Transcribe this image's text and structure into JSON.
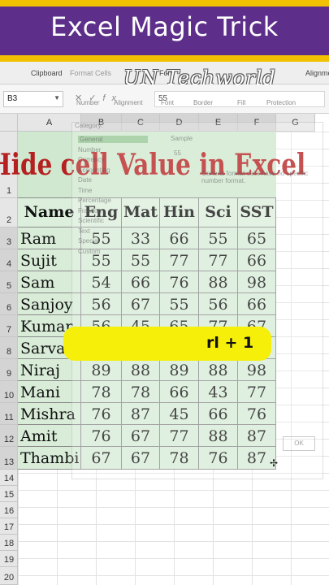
{
  "banner": {
    "title": "Excel Magic Trick"
  },
  "watermark": "UN Techworld",
  "ribbon": {
    "clipboard": "Clipboard",
    "format_cells": "Format Cells",
    "font": "Font",
    "alignment": "Alignme"
  },
  "formula_bar": {
    "name_box": "B3",
    "value": "55"
  },
  "dialog_ghost": {
    "tabs": [
      "Number",
      "Alignment",
      "Font",
      "Border",
      "Fill",
      "Protection"
    ],
    "category_label": "Category:",
    "categories": [
      "General",
      "Number",
      "Currency",
      "Accounting",
      "Date",
      "Time",
      "Percentage",
      "Fraction",
      "Scientific",
      "Text",
      "Special",
      "Custom"
    ],
    "sample_label": "Sample",
    "sample_value": "55",
    "note": "General format cells have no specific number format.",
    "ok_label": "OK"
  },
  "columns": [
    "A",
    "B",
    "C",
    "D",
    "E",
    "F",
    "G"
  ],
  "rows": [
    "1",
    "2",
    "3",
    "4",
    "5",
    "6",
    "7",
    "8",
    "9",
    "10",
    "11",
    "12",
    "13",
    "14",
    "15",
    "16",
    "17",
    "18",
    "19",
    "20"
  ],
  "sheet": {
    "title": "Hide cell Value in Excel",
    "headers": [
      "Name",
      "Eng",
      "Mat",
      "Hin",
      "Sci",
      "SST"
    ],
    "records": [
      [
        "Ram",
        "55",
        "33",
        "66",
        "55",
        "65"
      ],
      [
        "Sujit",
        "55",
        "55",
        "77",
        "77",
        "66"
      ],
      [
        "Sam",
        "54",
        "66",
        "76",
        "88",
        "98"
      ],
      [
        "Sanjoy",
        "56",
        "67",
        "55",
        "56",
        "66"
      ],
      [
        "Kumar",
        "56",
        "45",
        "65",
        "77",
        "67"
      ],
      [
        "Sarvan",
        "",
        "",
        "",
        "",
        ""
      ],
      [
        "Niraj",
        "89",
        "88",
        "89",
        "88",
        "98"
      ],
      [
        "Mani",
        "78",
        "78",
        "66",
        "43",
        "77"
      ],
      [
        "Mishra",
        "76",
        "87",
        "45",
        "66",
        "76"
      ],
      [
        "Amit",
        "76",
        "67",
        "77",
        "88",
        "87"
      ],
      [
        "Thambi",
        "67",
        "67",
        "78",
        "76",
        "87"
      ]
    ]
  },
  "shortcut": {
    "text": "rl + 1"
  }
}
